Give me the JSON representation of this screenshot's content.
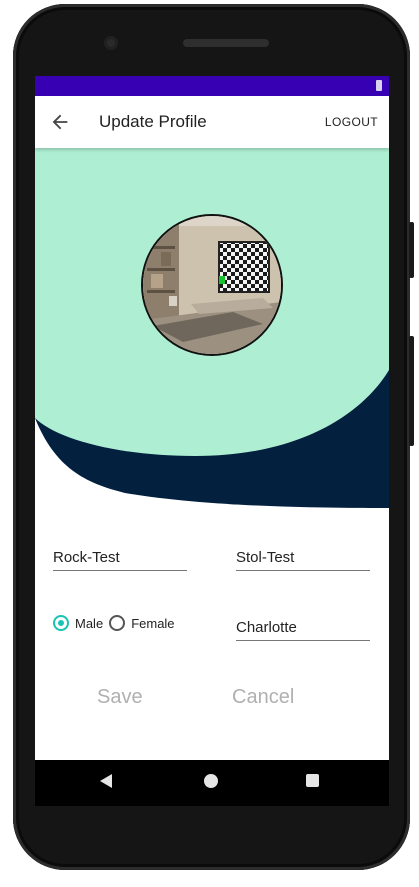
{
  "toolbar": {
    "title": "Update Profile",
    "logout_label": "LOGOUT",
    "back_icon": "arrow-left-icon"
  },
  "colors": {
    "status_bar": "#3700b3",
    "hero_mint": "#aeeed3",
    "hero_navy": "#03203f",
    "radio_accent": "#17c4b5"
  },
  "form": {
    "first_name": "Rock-Test",
    "last_name": "Stol-Test",
    "gender_options": [
      "Male",
      "Female"
    ],
    "gender_selected": "Male",
    "city": "Charlotte"
  },
  "actions": {
    "save_label": "Save",
    "cancel_label": "Cancel"
  },
  "navigation": {
    "icons": [
      "back-triangle-icon",
      "home-circle-icon",
      "recents-square-icon"
    ]
  }
}
